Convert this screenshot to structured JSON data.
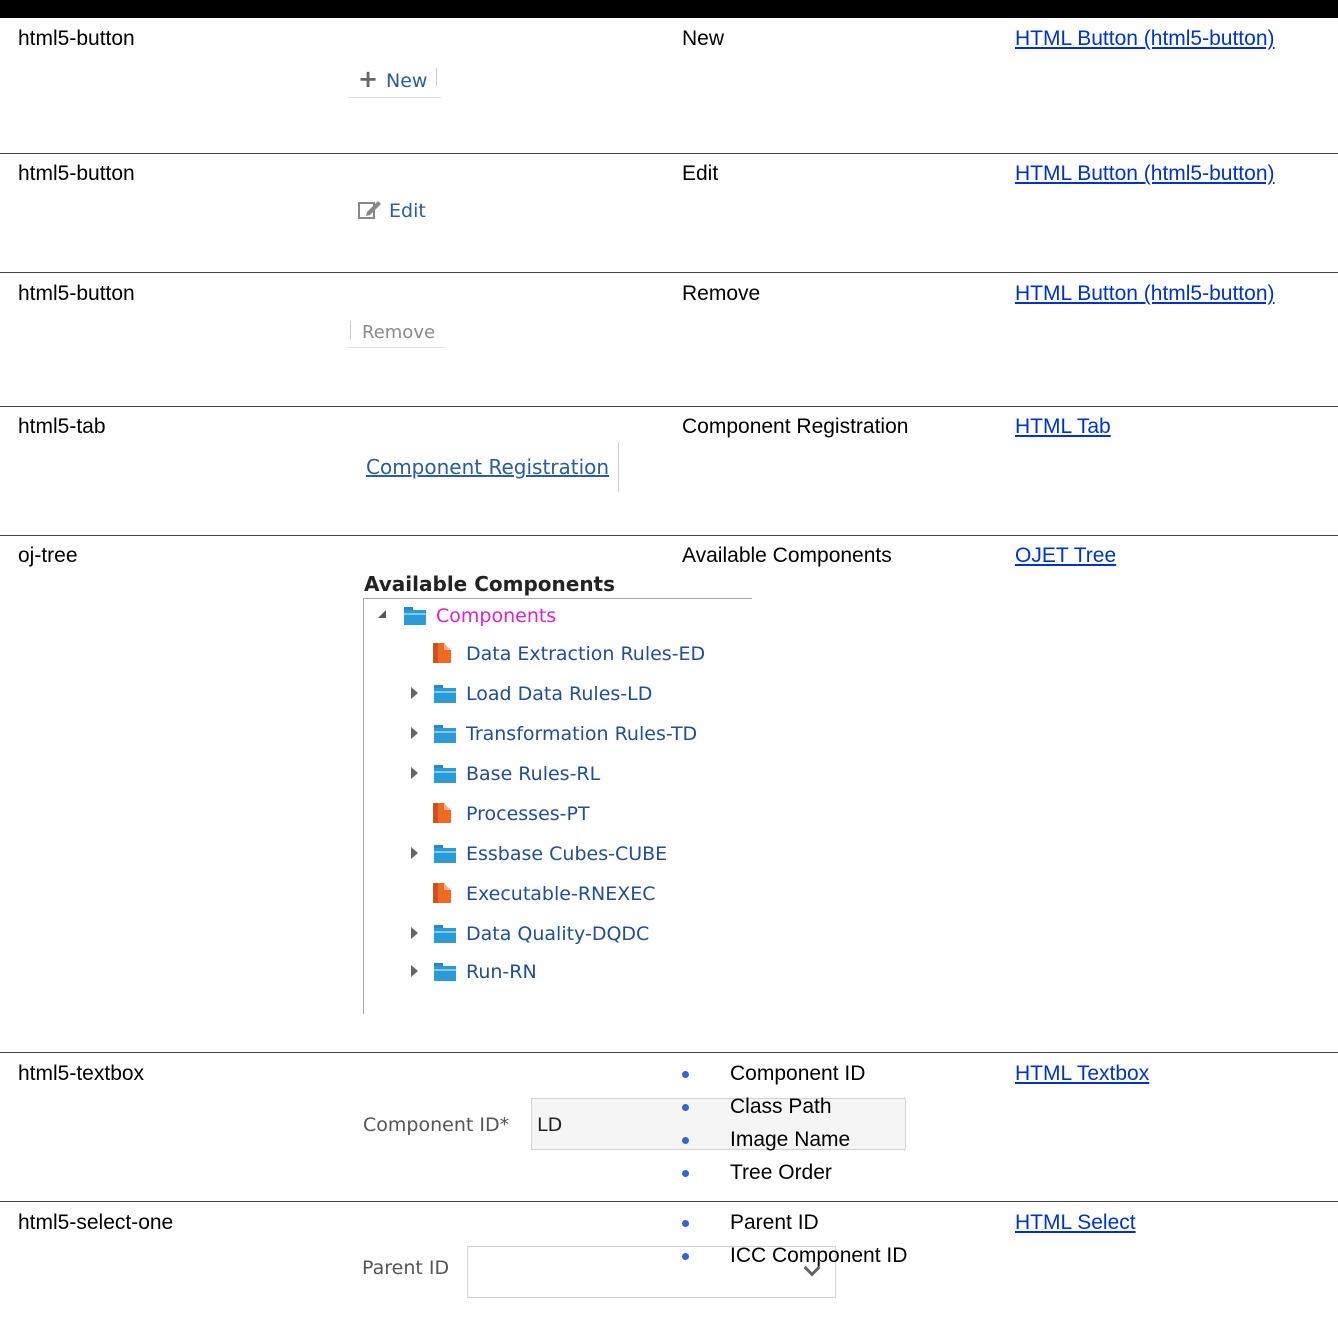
{
  "rows": [
    {
      "name": "html5-button",
      "label": "New",
      "link": "HTML Button (html5-button)",
      "shot_text": "New"
    },
    {
      "name": "html5-button",
      "label": "Edit",
      "link": "HTML Button (html5-button)",
      "shot_text": "Edit"
    },
    {
      "name": "html5-button",
      "label": "Remove",
      "link": "HTML Button (html5-button)",
      "shot_text": "Remove"
    },
    {
      "name": "html5-tab",
      "label": "Component Registration",
      "link": "HTML Tab",
      "shot_text": "Component Registration"
    },
    {
      "name": "oj-tree",
      "label": "Available Components",
      "link": "OJET Tree",
      "shot_text": "Available Components"
    },
    {
      "name": "html5-textbox",
      "labels": [
        "Component ID",
        "Class Path",
        "Image Name",
        "Tree Order"
      ],
      "link": "HTML Textbox",
      "shot_label": "Component ID*",
      "shot_value": "LD"
    },
    {
      "name": "html5-select-one",
      "labels": [
        "Parent ID",
        "ICC Component ID"
      ],
      "link": "HTML Select",
      "shot_label": "Parent ID"
    }
  ],
  "tree": {
    "root": "Components",
    "children": [
      {
        "label": "Data Extraction Rules-ED",
        "icon": "file-icon",
        "expandable": false
      },
      {
        "label": "Load Data Rules-LD",
        "icon": "folder-icon",
        "expandable": true
      },
      {
        "label": "Transformation Rules-TD",
        "icon": "folder-icon",
        "expandable": true
      },
      {
        "label": "Base Rules-RL",
        "icon": "folder-icon",
        "expandable": true
      },
      {
        "label": "Processes-PT",
        "icon": "file-icon",
        "expandable": false
      },
      {
        "label": "Essbase Cubes-CUBE",
        "icon": "folder-icon",
        "expandable": true
      },
      {
        "label": "Executable-RNEXEC",
        "icon": "file-icon",
        "expandable": false
      },
      {
        "label": "Data Quality-DQDC",
        "icon": "folder-icon",
        "expandable": true
      },
      {
        "label": "Run-RN",
        "icon": "folder-icon",
        "expandable": true
      }
    ]
  },
  "colors": {
    "link": "#0033cc",
    "tree_text": "#1f4f96",
    "tree_root": "#e020d0",
    "folder": "#2a9bd6",
    "file": "#ef6a21",
    "bullet": "#3366cc"
  }
}
